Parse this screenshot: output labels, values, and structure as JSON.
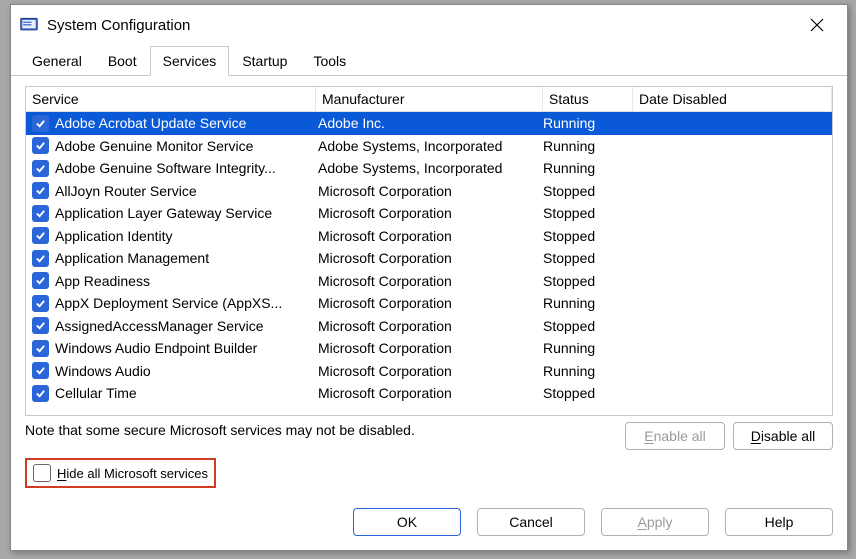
{
  "window": {
    "title": "System Configuration"
  },
  "tabs": [
    {
      "label": "General",
      "active": false
    },
    {
      "label": "Boot",
      "active": false
    },
    {
      "label": "Services",
      "active": true
    },
    {
      "label": "Startup",
      "active": false
    },
    {
      "label": "Tools",
      "active": false
    }
  ],
  "columns": {
    "service": "Service",
    "manufacturer": "Manufacturer",
    "status": "Status",
    "date_disabled": "Date Disabled"
  },
  "rows": [
    {
      "checked": true,
      "service": "Adobe Acrobat Update Service",
      "manufacturer": "Adobe Inc.",
      "status": "Running",
      "date_disabled": "",
      "selected": true
    },
    {
      "checked": true,
      "service": "Adobe Genuine Monitor Service",
      "manufacturer": "Adobe Systems, Incorporated",
      "status": "Running",
      "date_disabled": ""
    },
    {
      "checked": true,
      "service": "Adobe Genuine Software Integrity...",
      "manufacturer": "Adobe Systems, Incorporated",
      "status": "Running",
      "date_disabled": ""
    },
    {
      "checked": true,
      "service": "AllJoyn Router Service",
      "manufacturer": "Microsoft Corporation",
      "status": "Stopped",
      "date_disabled": ""
    },
    {
      "checked": true,
      "service": "Application Layer Gateway Service",
      "manufacturer": "Microsoft Corporation",
      "status": "Stopped",
      "date_disabled": ""
    },
    {
      "checked": true,
      "service": "Application Identity",
      "manufacturer": "Microsoft Corporation",
      "status": "Stopped",
      "date_disabled": ""
    },
    {
      "checked": true,
      "service": "Application Management",
      "manufacturer": "Microsoft Corporation",
      "status": "Stopped",
      "date_disabled": ""
    },
    {
      "checked": true,
      "service": "App Readiness",
      "manufacturer": "Microsoft Corporation",
      "status": "Stopped",
      "date_disabled": ""
    },
    {
      "checked": true,
      "service": "AppX Deployment Service (AppXS...",
      "manufacturer": "Microsoft Corporation",
      "status": "Running",
      "date_disabled": ""
    },
    {
      "checked": true,
      "service": "AssignedAccessManager Service",
      "manufacturer": "Microsoft Corporation",
      "status": "Stopped",
      "date_disabled": ""
    },
    {
      "checked": true,
      "service": "Windows Audio Endpoint Builder",
      "manufacturer": "Microsoft Corporation",
      "status": "Running",
      "date_disabled": ""
    },
    {
      "checked": true,
      "service": "Windows Audio",
      "manufacturer": "Microsoft Corporation",
      "status": "Running",
      "date_disabled": ""
    },
    {
      "checked": true,
      "service": "Cellular Time",
      "manufacturer": "Microsoft Corporation",
      "status": "Stopped",
      "date_disabled": ""
    }
  ],
  "note": "Note that some secure Microsoft services may not be disabled.",
  "buttons": {
    "enable_all": "Enable all",
    "disable_all": "Disable all",
    "ok": "OK",
    "cancel": "Cancel",
    "apply": "Apply",
    "help": "Help"
  },
  "hide_checkbox": {
    "label_pre": "H",
    "label_post": "ide all Microsoft services"
  }
}
